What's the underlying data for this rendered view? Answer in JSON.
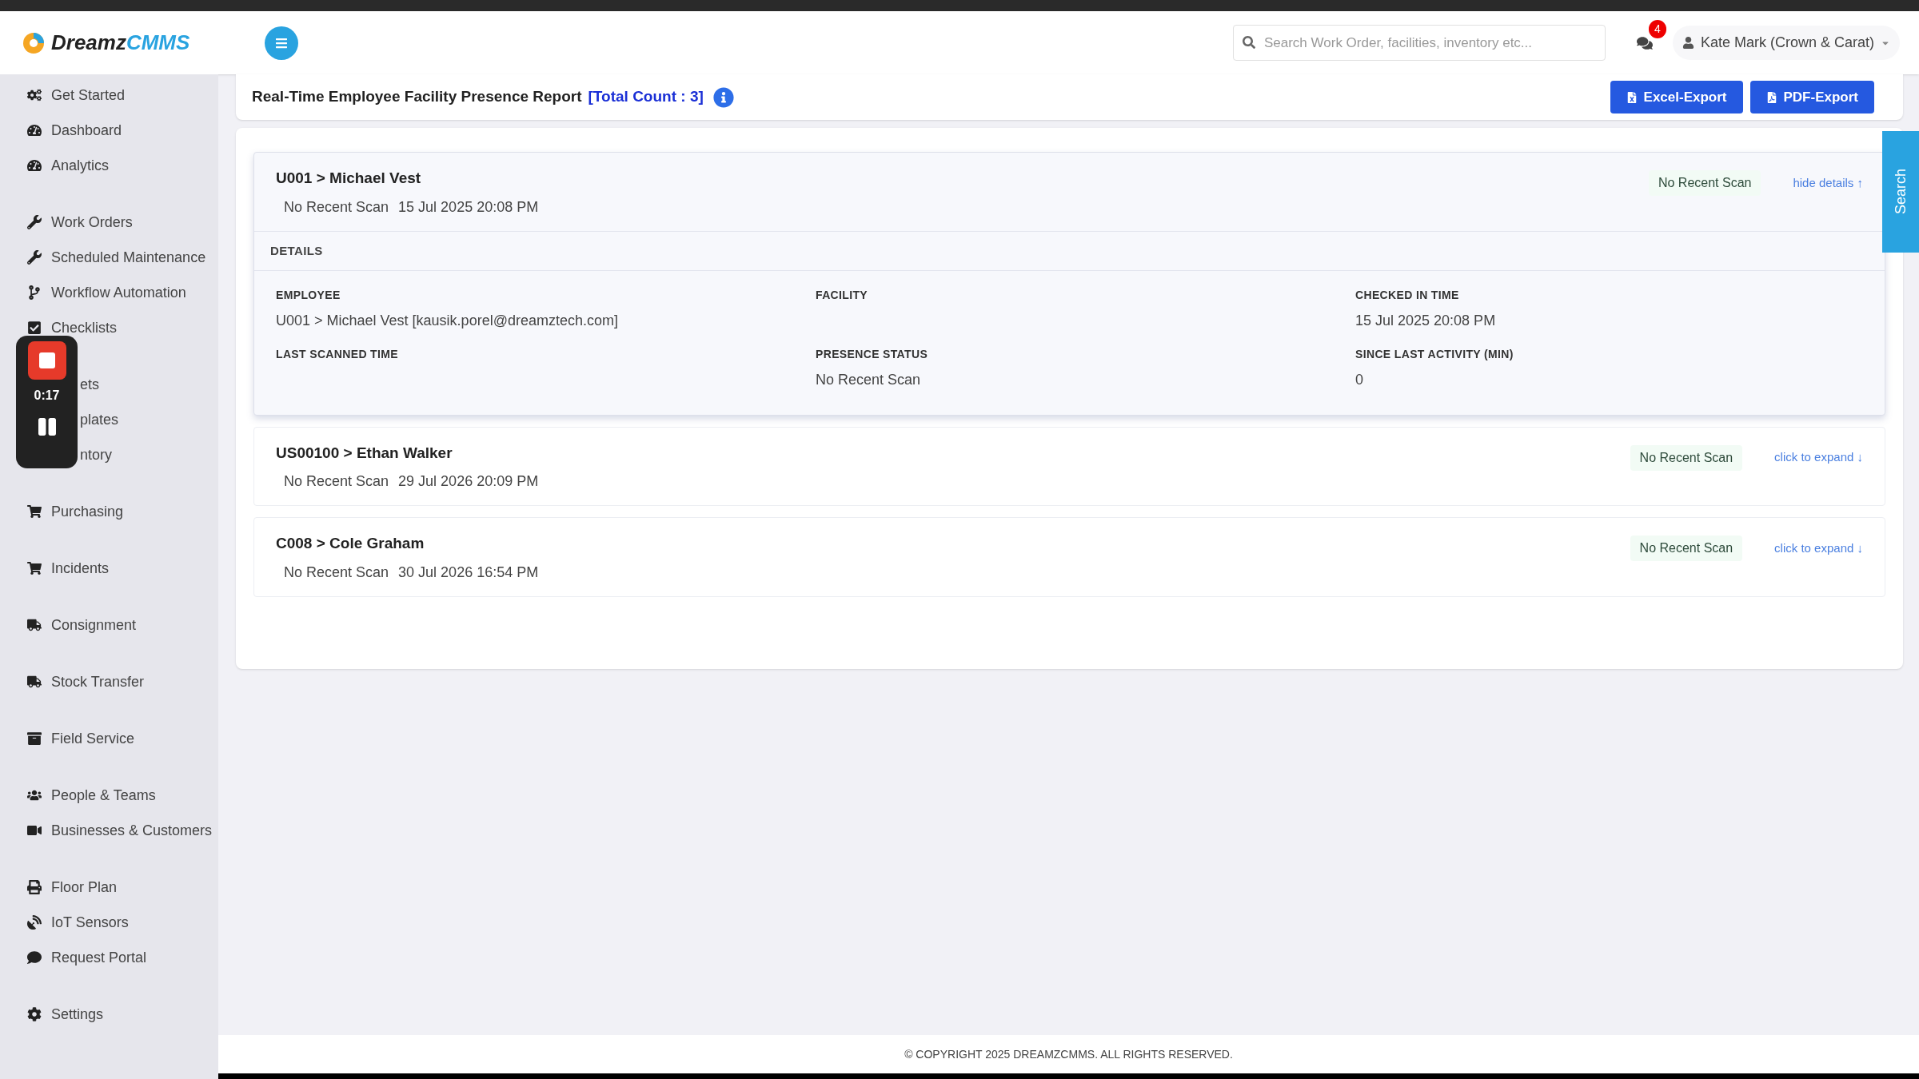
{
  "header": {
    "logo": {
      "word1": "Dreamz",
      "word2": "CMMS"
    },
    "search": {
      "placeholder": "Search Work Order, facilities, inventory etc..."
    },
    "notifications": {
      "count": "4"
    },
    "user": {
      "name": "Kate Mark (Crown & Carat)"
    }
  },
  "sidebar": {
    "groups": [
      [
        {
          "label": "Get Started"
        },
        {
          "label": "Dashboard"
        },
        {
          "label": "Analytics"
        }
      ],
      [
        {
          "label": "Work Orders"
        },
        {
          "label": "Scheduled Maintenance"
        },
        {
          "label": "Workflow Automation"
        },
        {
          "label": "Checklists"
        }
      ],
      [
        {
          "label": "ets",
          "covered": true
        },
        {
          "label": "plates",
          "covered": true
        },
        {
          "label": "ntory",
          "covered": true
        }
      ],
      [
        {
          "label": "Purchasing"
        }
      ],
      [
        {
          "label": "Incidents"
        }
      ],
      [
        {
          "label": "Consignment"
        }
      ],
      [
        {
          "label": "Stock Transfer"
        }
      ],
      [
        {
          "label": "Field Service"
        }
      ],
      [
        {
          "label": "People & Teams"
        },
        {
          "label": "Businesses & Customers"
        }
      ],
      [
        {
          "label": "Floor Plan"
        },
        {
          "label": "IoT Sensors"
        },
        {
          "label": "Request Portal"
        }
      ],
      [
        {
          "label": "Settings"
        }
      ]
    ]
  },
  "recorder": {
    "time": "0:17"
  },
  "report": {
    "title": "Real-Time Employee Facility Presence Report",
    "count": "[Total Count : 3]",
    "buttons": [
      "Excel-Export",
      "PDF-Export"
    ]
  },
  "side_tab": {
    "label": "Search"
  },
  "employees": [
    {
      "name": "U001 > Michael Vest",
      "status": "No Recent Scan",
      "time": "15 Jul 2025 20:08 PM",
      "badge": "No Recent Scan",
      "toggle": "hide details ↑",
      "expanded": true,
      "details": {
        "heading": "DETAILS",
        "fields": [
          {
            "label": "EMPLOYEE",
            "value": "U001 > Michael Vest [kausik.porel@dreamztech.com]"
          },
          {
            "label": "FACILITY"
          },
          {
            "label": "CHECKED IN TIME",
            "value": "15 Jul 2025 20:08 PM"
          },
          {
            "label": "LAST SCANNED TIME"
          },
          {
            "label": "PRESENCE STATUS",
            "value": "No Recent Scan"
          },
          {
            "label": "SINCE LAST ACTIVITY (MIN)",
            "value": "0"
          }
        ]
      }
    },
    {
      "name": "US00100 > Ethan Walker",
      "status": "No Recent Scan",
      "time": "29 Jul 2026 20:09 PM",
      "badge": "No Recent Scan",
      "toggle": "click to expand ↓",
      "expanded": false
    },
    {
      "name": "C008 > Cole Graham",
      "status": "No Recent Scan",
      "time": "30 Jul 2026 16:54 PM",
      "badge": "No Recent Scan",
      "toggle": "click to expand ↓",
      "expanded": false
    }
  ],
  "footer": {
    "text": "© COPYRIGHT 2025 DREAMZCMMS. ALL RIGHTS RESERVED."
  }
}
